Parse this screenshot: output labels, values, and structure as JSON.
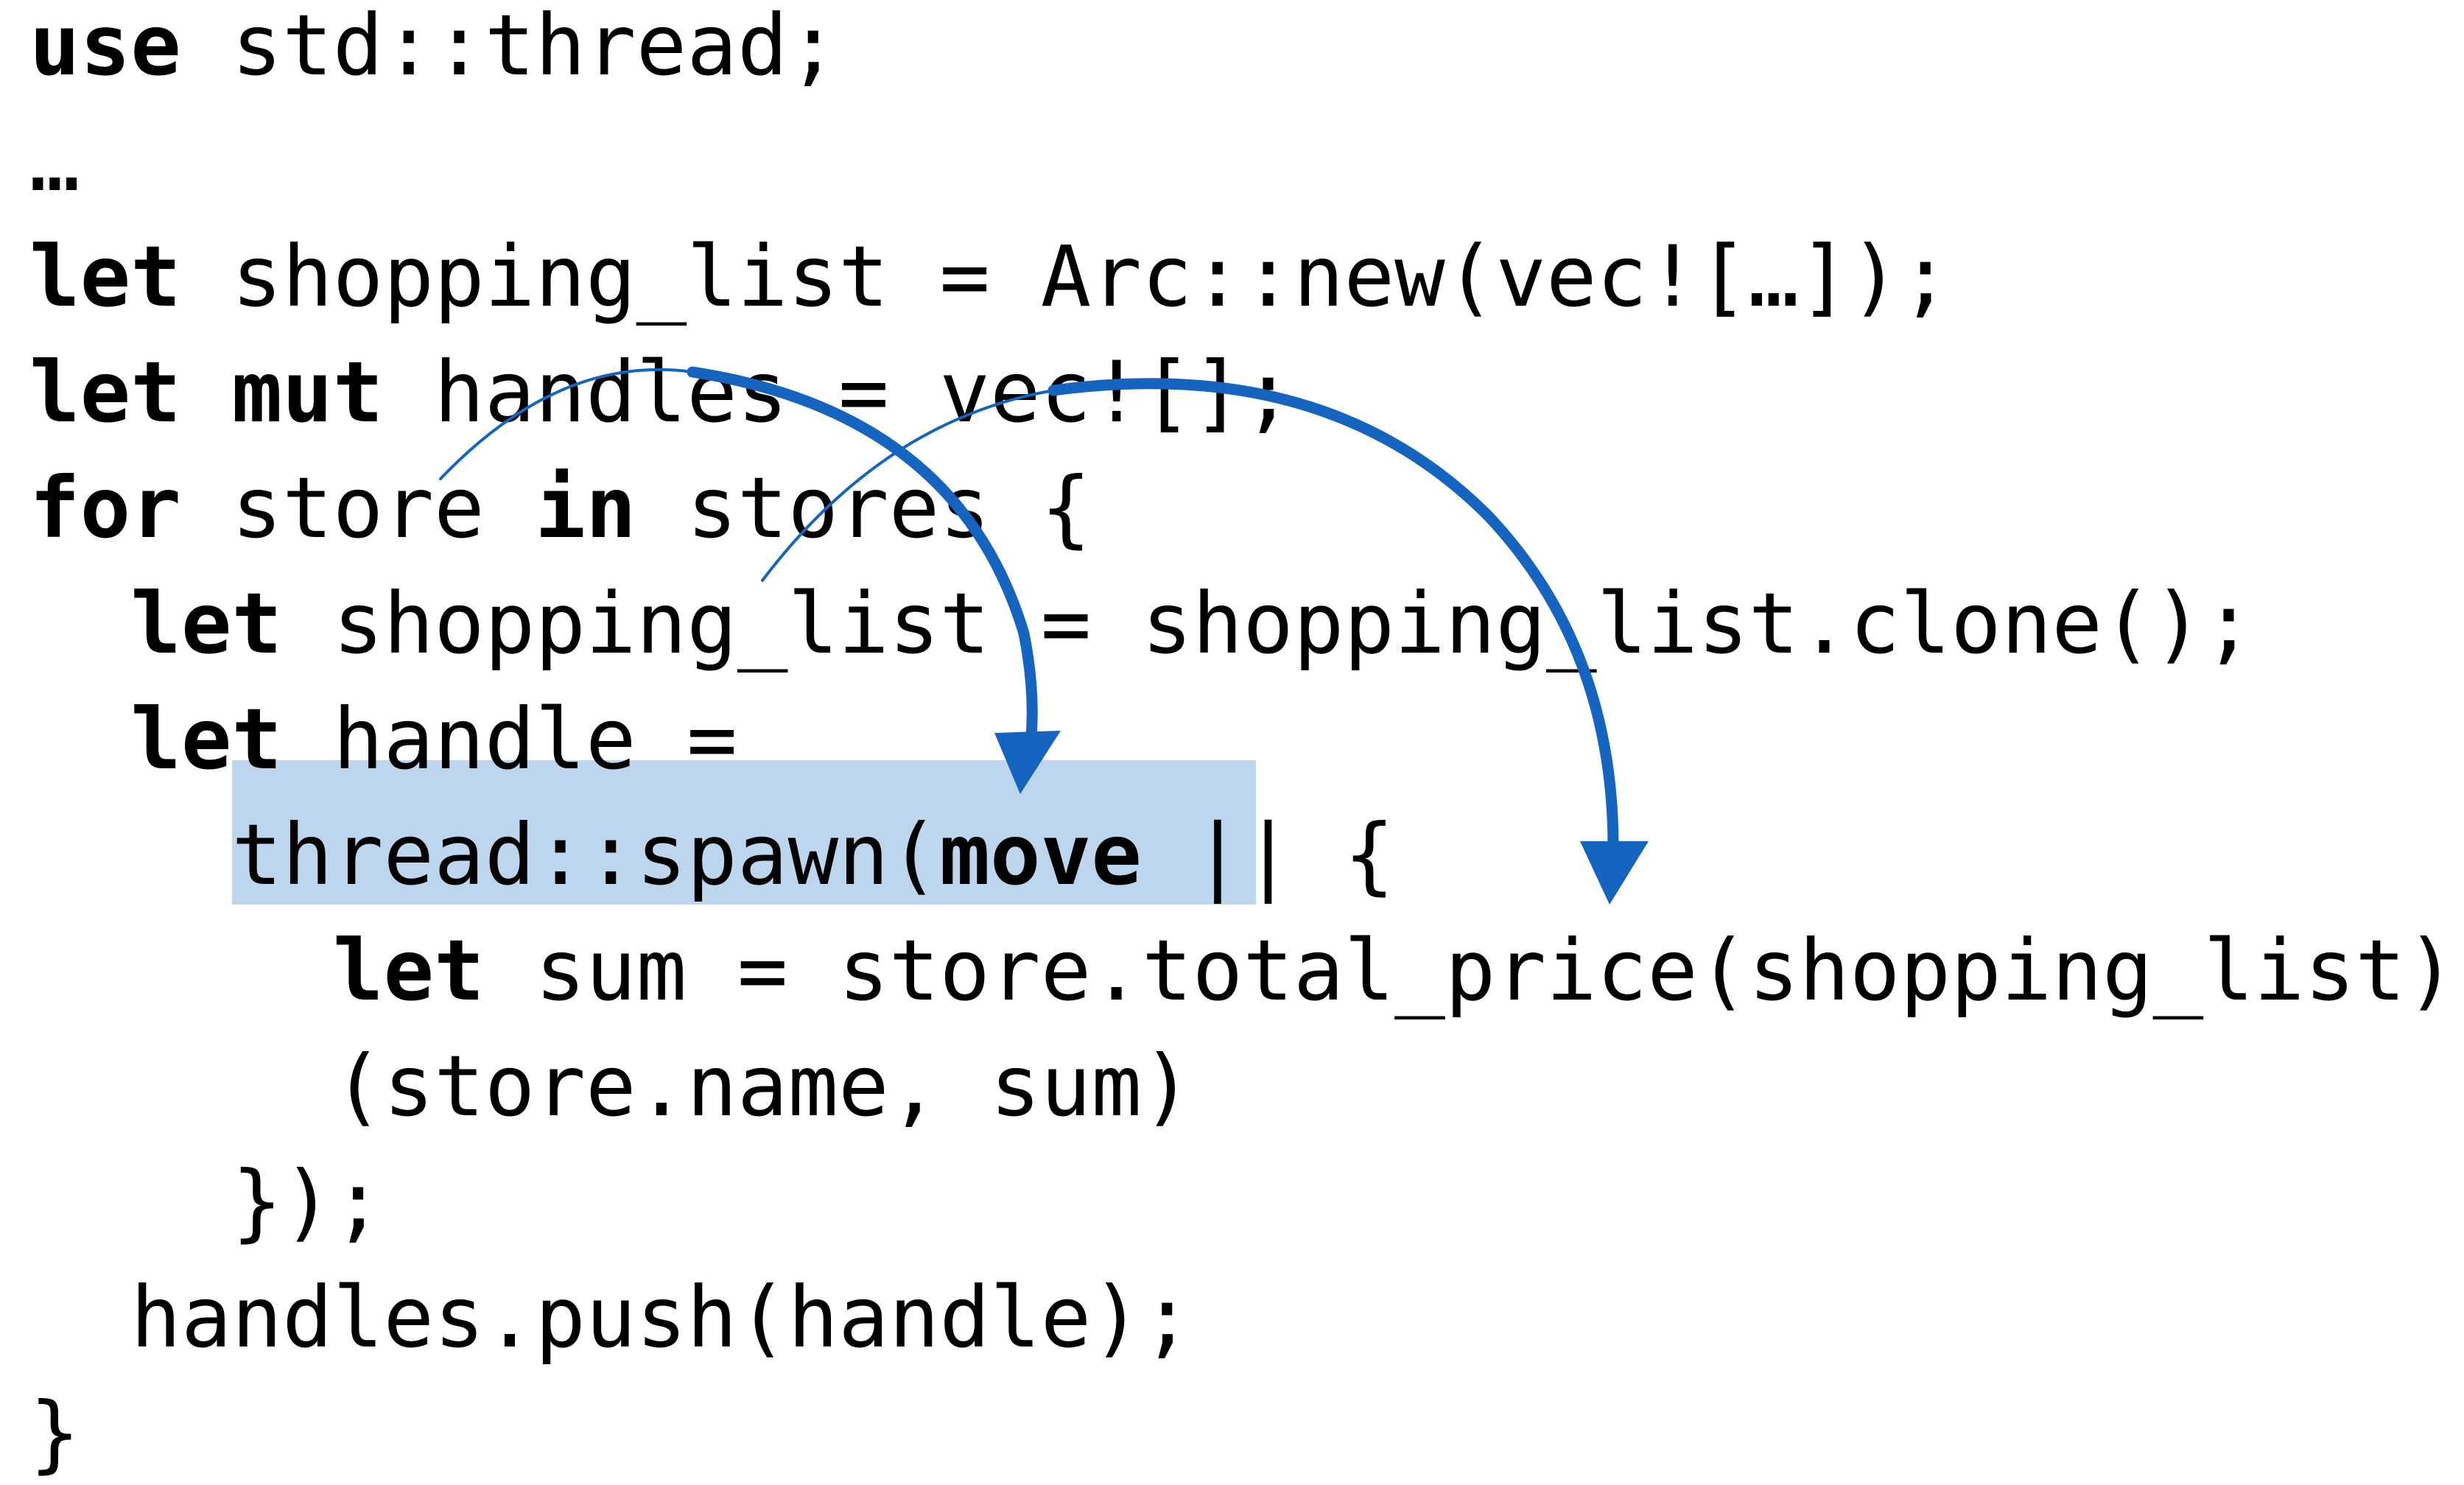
{
  "colors": {
    "text": "#000000",
    "highlight": "#bed5ee",
    "arrow": "#1565c0"
  },
  "code": {
    "lines": [
      {
        "indent": 0,
        "tokens": [
          {
            "kw": true,
            "text": "use"
          },
          {
            "kw": false,
            "text": " std::thread;"
          }
        ]
      },
      {
        "indent": 0,
        "tokens": [
          {
            "kw": false,
            "text": "…"
          }
        ]
      },
      {
        "indent": 0,
        "tokens": [
          {
            "kw": true,
            "text": "let"
          },
          {
            "kw": false,
            "text": " shopping_list = Arc::new(vec![…]);"
          }
        ]
      },
      {
        "indent": 0,
        "tokens": [
          {
            "kw": true,
            "text": "let"
          },
          {
            "kw": false,
            "text": " "
          },
          {
            "kw": true,
            "text": "mut"
          },
          {
            "kw": false,
            "text": " handles = vec![];"
          }
        ]
      },
      {
        "indent": 0,
        "tokens": [
          {
            "kw": true,
            "text": "for"
          },
          {
            "kw": false,
            "text": " store "
          },
          {
            "kw": true,
            "text": "in"
          },
          {
            "kw": false,
            "text": " stores {"
          }
        ]
      },
      {
        "indent": 2,
        "tokens": [
          {
            "kw": true,
            "text": "let"
          },
          {
            "kw": false,
            "text": " shopping_list = shopping_list.clone();"
          }
        ]
      },
      {
        "indent": 2,
        "tokens": [
          {
            "kw": true,
            "text": "let"
          },
          {
            "kw": false,
            "text": " handle ="
          }
        ]
      },
      {
        "indent": 4,
        "tokens": [
          {
            "kw": false,
            "text": "thread::spawn("
          },
          {
            "kw": true,
            "text": "move"
          },
          {
            "kw": false,
            "text": " || {"
          }
        ]
      },
      {
        "indent": 6,
        "tokens": [
          {
            "kw": true,
            "text": "let"
          },
          {
            "kw": false,
            "text": " sum = store.total_price(shopping_list);"
          }
        ]
      },
      {
        "indent": 6,
        "tokens": [
          {
            "kw": false,
            "text": "(store.name, sum)"
          }
        ]
      },
      {
        "indent": 4,
        "tokens": [
          {
            "kw": false,
            "text": "});"
          }
        ]
      },
      {
        "indent": 2,
        "tokens": [
          {
            "kw": false,
            "text": "handles.push(handle);"
          }
        ]
      },
      {
        "indent": 0,
        "tokens": [
          {
            "kw": false,
            "text": "}"
          }
        ]
      }
    ]
  },
  "arrows": [
    {
      "name": "store-move-arrow",
      "from": "store",
      "to": "move"
    },
    {
      "name": "shopping-list-move-arrow",
      "from": "shopping_list",
      "to": "||"
    }
  ]
}
